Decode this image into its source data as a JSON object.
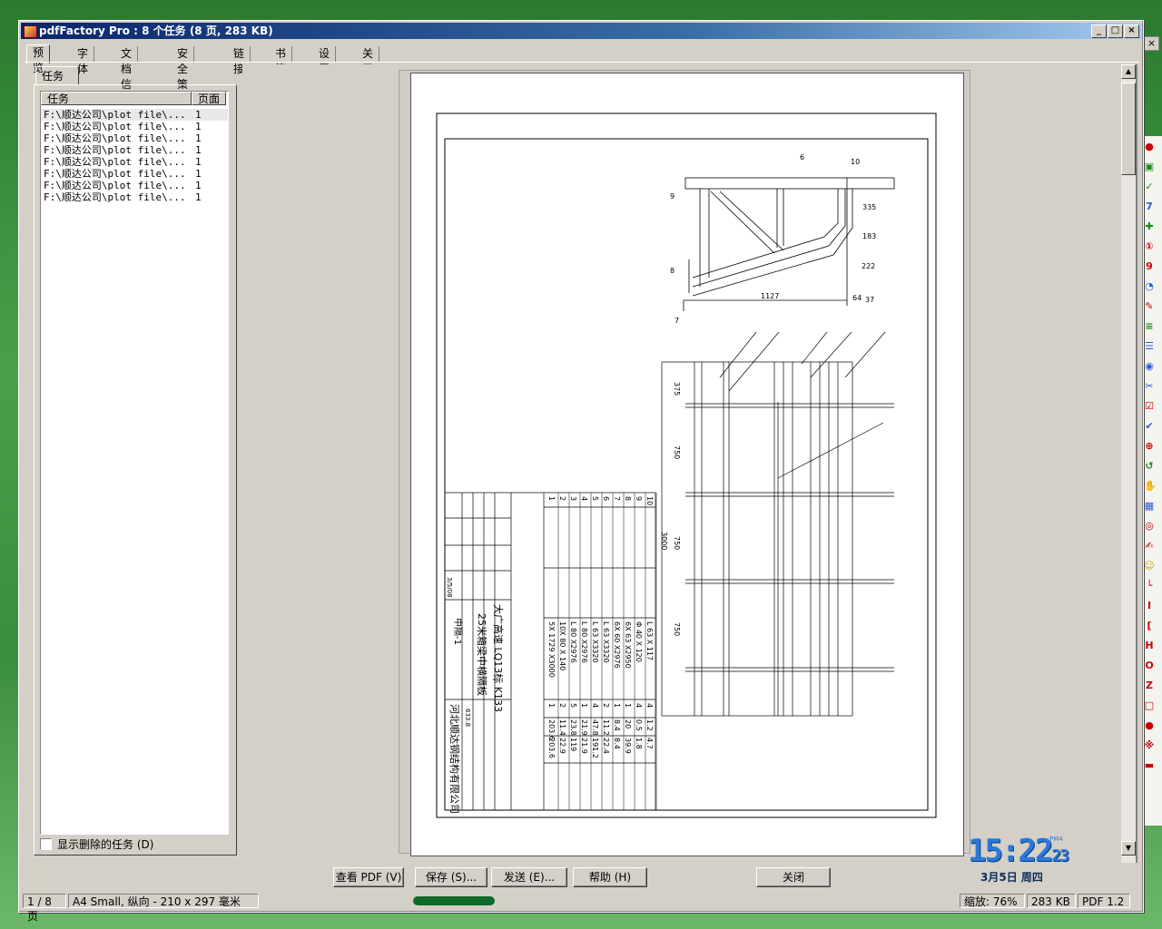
{
  "window": {
    "title": "pdfFactory Pro : 8 个任务 (8 页, 283 KB)",
    "controls": [
      "_",
      "□",
      "×"
    ]
  },
  "tabs": [
    "预览",
    "字体",
    "文档信息",
    "安全策略",
    "链接",
    "书签",
    "设置",
    "关于"
  ],
  "jobs_panel": {
    "tab_label": "任务",
    "col_task": "任务",
    "col_pages": "页面",
    "rows": [
      {
        "task": "F:\\顺达公司\\plot file\\...",
        "pages": "1"
      },
      {
        "task": "F:\\顺达公司\\plot file\\...",
        "pages": "1"
      },
      {
        "task": "F:\\顺达公司\\plot file\\...",
        "pages": "1"
      },
      {
        "task": "F:\\顺达公司\\plot file\\...",
        "pages": "1"
      },
      {
        "task": "F:\\顺达公司\\plot file\\...",
        "pages": "1"
      },
      {
        "task": "F:\\顺达公司\\plot file\\...",
        "pages": "1"
      },
      {
        "task": "F:\\顺达公司\\plot file\\...",
        "pages": "1"
      },
      {
        "task": "F:\\顺达公司\\plot file\\...",
        "pages": "1"
      }
    ],
    "show_deleted_label": "显示删除的任务 (D)"
  },
  "drawing": {
    "dims_top": [
      "1127",
      "64",
      "37",
      "222",
      "183",
      "335",
      "10",
      "9",
      "8",
      "7",
      "6"
    ],
    "dims_left": [
      "375",
      "750",
      "3000",
      "750",
      "750"
    ],
    "table_title": "大广高速 LQ13标 K133",
    "table_subtitle": "25米箱梁中横隔板",
    "company": "河北顺达钢结构有限公司",
    "sheet": "中隔-1",
    "date": "3/5/08",
    "rows": [
      {
        "no": "1",
        "spec": "5X 1729 X3000",
        "qty": "1",
        "w1": "203.6",
        "w2": "203.6"
      },
      {
        "no": "2",
        "spec": "10X 80 X 140",
        "qty": "2",
        "w1": "11.4",
        "w2": "22.9"
      },
      {
        "no": "3",
        "spec": "L 80 X2976",
        "qty": "5",
        "w1": "23.8",
        "w2": "119"
      },
      {
        "no": "4",
        "spec": "L 80 X2976",
        "qty": "1",
        "w1": "21.9",
        "w2": "21.9"
      },
      {
        "no": "5",
        "spec": "L 63 X3320",
        "qty": "4",
        "w1": "47.8",
        "w2": "191.2"
      },
      {
        "no": "6",
        "spec": "L 63 X3320",
        "qty": "2",
        "w1": "11.2",
        "w2": "22.4"
      },
      {
        "no": "7",
        "spec": "6X 60 X2976",
        "qty": "1",
        "w1": "8.4",
        "w2": "8.4"
      },
      {
        "no": "8",
        "spec": "6X 63 X2950",
        "qty": "1",
        "w1": "20",
        "w2": "39.9"
      },
      {
        "no": "9",
        "spec": "Φ 40 X 120",
        "qty": "4",
        "w1": "0.5",
        "w2": "1.8"
      },
      {
        "no": "10",
        "spec": "L 63 X 117",
        "qty": "4",
        "w1": "1.2",
        "w2": "4.7"
      }
    ],
    "total": "633.8"
  },
  "buttons": {
    "view_pdf": "查看 PDF (V)",
    "save": "保存 (S)...",
    "send": "发送 (E)...",
    "help": "帮助 (H)",
    "close": "关闭"
  },
  "status": {
    "page": "1 / 8 页",
    "paper": "A4 Small, 纵向 - 210 x 297 毫米",
    "zoom": "缩放: 76%",
    "size": "283 KB",
    "pdf_version": "PDF 1.2"
  },
  "clock": {
    "time": "15:22",
    "seconds": "23",
    "ampm": "PM4",
    "date": "3月5日  周四"
  },
  "colors": {
    "title_start": "#0a246a",
    "title_end": "#a6caf0",
    "clock": "#2b78d8",
    "desktop": "#3a8d3c"
  }
}
